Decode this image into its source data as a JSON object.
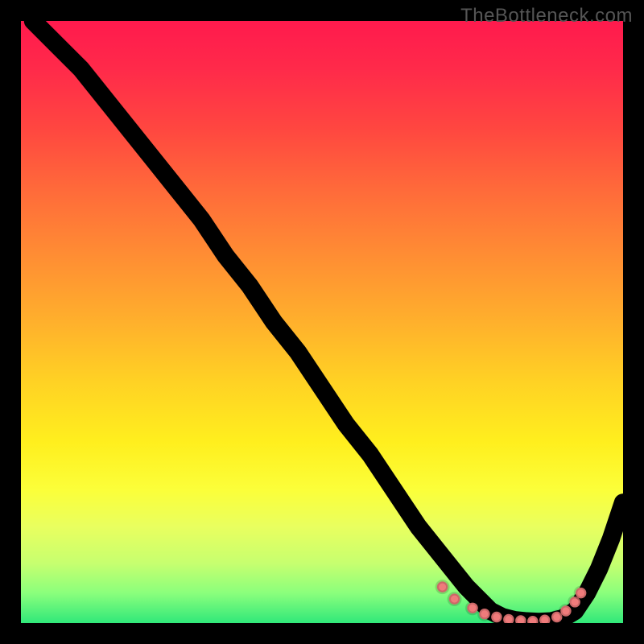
{
  "watermark": "TheBottleneck.com",
  "chart_data": {
    "type": "line",
    "title": "",
    "xlabel": "",
    "ylabel": "",
    "xlim": [
      0,
      100
    ],
    "ylim": [
      0,
      100
    ],
    "grid": false,
    "legend": false,
    "background": "rainbow-vertical",
    "series": [
      {
        "name": "bottleneck-curve",
        "x": [
          2,
          6,
          10,
          14,
          18,
          22,
          26,
          30,
          34,
          38,
          42,
          46,
          50,
          54,
          58,
          62,
          66,
          70,
          74,
          78,
          80,
          82,
          84,
          86,
          88,
          90,
          92,
          94,
          96,
          98,
          100
        ],
        "y": [
          100,
          96,
          92,
          87,
          82,
          77,
          72,
          67,
          61,
          56,
          50,
          45,
          39,
          33,
          28,
          22,
          16,
          11,
          6,
          2,
          1,
          0.5,
          0.3,
          0.2,
          0.3,
          0.8,
          2,
          5,
          9,
          14,
          20
        ]
      }
    ],
    "markers": [
      {
        "x": 70,
        "y": 6
      },
      {
        "x": 72,
        "y": 4
      },
      {
        "x": 75,
        "y": 2.5
      },
      {
        "x": 77,
        "y": 1.5
      },
      {
        "x": 79,
        "y": 1
      },
      {
        "x": 81,
        "y": 0.6
      },
      {
        "x": 83,
        "y": 0.4
      },
      {
        "x": 85,
        "y": 0.3
      },
      {
        "x": 87,
        "y": 0.5
      },
      {
        "x": 89,
        "y": 1
      },
      {
        "x": 90.5,
        "y": 2
      },
      {
        "x": 92,
        "y": 3.5
      },
      {
        "x": 93,
        "y": 5
      }
    ]
  }
}
